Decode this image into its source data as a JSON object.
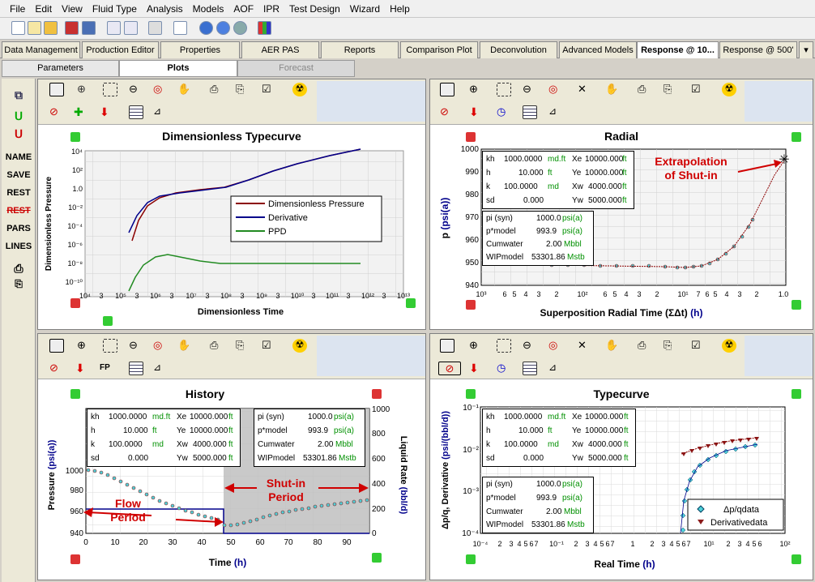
{
  "menu": [
    "File",
    "Edit",
    "View",
    "Fluid Type",
    "Analysis",
    "Models",
    "AOF",
    "IPR",
    "Test Design",
    "Wizard",
    "Help"
  ],
  "tabs": [
    "Data Management",
    "Production Editor",
    "Properties",
    "AER PAS",
    "Reports",
    "Comparison Plot",
    "Deconvolution",
    "Advanced Models",
    "Response @ 10...",
    "Response @ 500'"
  ],
  "subtabs": [
    "Parameters",
    "Plots",
    "Forecast"
  ],
  "left_buttons": [
    "NAME",
    "SAVE",
    "REST",
    "REST",
    "PARS",
    "LINES"
  ],
  "colors": {
    "pressure": "#8b0000",
    "derivative": "#00008b",
    "ppd": "#228b22",
    "data_marker": "#4fd1d9",
    "deriv_marker": "#8b1a1a",
    "accent": "#d00000"
  },
  "reservoir": {
    "kh_label": "kh",
    "kh_val": "1000.0000",
    "kh_unit": "md.ft",
    "xe_label": "Xe",
    "xe_val": "10000.000",
    "xe_unit": "ft",
    "h_label": "h",
    "h_val": "10.000",
    "h_unit": "ft",
    "ye_label": "Ye",
    "ye_val": "10000.000",
    "ye_unit": "ft",
    "k_label": "k",
    "k_val": "100.0000",
    "k_unit": "md",
    "xw_label": "Xw",
    "xw_val": "4000.000",
    "xw_unit": "ft",
    "sd_label": "sd",
    "sd_val": "0.000",
    "yw_label": "Yw",
    "yw_val": "5000.000",
    "yw_unit": "ft"
  },
  "results": {
    "pi_label": "pi (syn)",
    "pi_val": "1000.0",
    "pi_unit": "psi(a)",
    "ps_label": "p*model",
    "ps_val": "993.9",
    "ps_unit": "psi(a)",
    "cum_label": "Cumwater",
    "cum_val": "2.00",
    "cum_unit": "Mbbl",
    "wip_label": "WIPmodel",
    "wip_val": "53301.86",
    "wip_unit": "Mstb"
  },
  "dtc": {
    "title": "Dimensionless Typecurve",
    "xlabel": "Dimensionless Time",
    "ylabel": "Dimensionless Pressure",
    "legend": [
      "Dimensionless Pressure",
      "Derivative",
      "PPD"
    ],
    "xticks": [
      "10⁴",
      "3",
      "10⁵",
      "3",
      "10⁶",
      "3",
      "10⁷",
      "3",
      "10⁸",
      "3",
      "10⁹",
      "3",
      "10¹⁰",
      "3",
      "10¹¹",
      "3",
      "10¹²",
      "3",
      "10¹³"
    ],
    "yticks": [
      "10⁴",
      "10²",
      "1.0",
      "10⁻²",
      "10⁻⁴",
      "10⁻⁶",
      "10⁻⁸",
      "10⁻¹⁰"
    ]
  },
  "radial": {
    "title": "Radial",
    "xlabel": "Superposition Radial Time (ΣΔt)",
    "xunit": "(h)",
    "ylabel": "p",
    "yunit": "(psi(a))",
    "annotation": [
      "Extrapolation",
      "of Shut-in"
    ],
    "yticks": [
      "1000",
      "990",
      "980",
      "970",
      "960",
      "950",
      "940"
    ],
    "xticks": [
      "10³",
      "6",
      "5",
      "4",
      "3",
      "2",
      "10²",
      "6",
      "5",
      "4",
      "3",
      "2",
      "10¹",
      "7",
      "6",
      "5",
      "4",
      "3",
      "2",
      "1.0"
    ]
  },
  "history": {
    "title": "History",
    "xlabel": "Time",
    "xunit": "(h)",
    "ylabel": "Pressure",
    "yunit": "(psi(a))",
    "y2label": "Liquid Rate",
    "y2unit": "(bbl/d)",
    "yticks": [
      "1000",
      "980",
      "960",
      "940"
    ],
    "y2ticks": [
      "1000",
      "800",
      "600",
      "400",
      "200",
      "0"
    ],
    "xticks": [
      "0",
      "10",
      "20",
      "30",
      "40",
      "50",
      "60",
      "70",
      "80",
      "90"
    ],
    "shutin": [
      "Shut-in",
      "Period"
    ],
    "flow": [
      "Flow",
      "Period"
    ]
  },
  "typecurve": {
    "title": "Typecurve",
    "xlabel": "Real Time",
    "xunit": "(h)",
    "ylabel": "Δp/q, Derivative",
    "yunit": "(psi/(bbl/d))",
    "yticks": [
      "10⁻¹",
      "10⁻²",
      "10⁻³",
      "10⁻⁴"
    ],
    "xticks": [
      "10⁻⁴",
      "2",
      "3",
      "4",
      "5",
      "6",
      "7",
      "10⁻¹",
      "2",
      "3",
      "4",
      "5",
      "6",
      "7",
      "1",
      "2",
      "3",
      "4",
      "5",
      "6",
      "7",
      "10¹",
      "2",
      "3",
      "4",
      "5",
      "6",
      "10²"
    ],
    "legend": [
      "Δp/qdata",
      "Derivativedata"
    ]
  },
  "fp_label": "FP",
  "chart_data": [
    {
      "type": "line",
      "title": "Dimensionless Typecurve",
      "xlabel": "Dimensionless Time",
      "ylabel": "Dimensionless Pressure",
      "log_x": true,
      "log_y": true,
      "xlim": [
        10000,
        10000000000000.0
      ],
      "ylim": [
        1e-10,
        10000
      ],
      "series": [
        {
          "name": "Dimensionless Pressure",
          "x": [
            300000.0,
            1000000.0,
            10000000.0,
            100000000.0,
            1000000000.0,
            10000000000.0,
            100000000000.0,
            1000000000000.0
          ],
          "y": [
            1e-05,
            0.03,
            0.15,
            0.5,
            3,
            20,
            150,
            1000
          ]
        },
        {
          "name": "Derivative",
          "x": [
            300000.0,
            1000000.0,
            10000000.0,
            100000000.0,
            1000000000.0,
            10000000000.0,
            100000000000.0,
            1000000000000.0
          ],
          "y": [
            5e-05,
            0.05,
            0.12,
            0.5,
            3,
            20,
            150,
            1000
          ]
        },
        {
          "name": "PPD",
          "x": [
            300000.0,
            1000000.0,
            3000000.0,
            10000000.0,
            100000000.0,
            1000000000.0,
            10000000000.0,
            100000000000.0,
            1000000000000.0
          ],
          "y": [
            3e-10,
            1e-07,
            2e-07,
            1e-07,
            1e-08,
            1e-08,
            1e-08,
            1e-08,
            1e-08
          ]
        }
      ]
    },
    {
      "type": "scatter",
      "title": "Radial",
      "xlabel": "Superposition Radial Time (ΣΔt) (h)",
      "ylabel": "p (psi(a))",
      "ylim": [
        940,
        1000
      ],
      "series": [
        {
          "name": "data",
          "x": [
            1000,
            500,
            200,
            100,
            50,
            20,
            10,
            5,
            3,
            2,
            1.5,
            1.2,
            1.0
          ],
          "y": [
            950,
            950,
            949,
            948,
            948,
            948,
            948,
            950,
            955,
            965,
            978,
            988,
            994
          ]
        }
      ]
    },
    {
      "type": "line",
      "title": "History",
      "xlabel": "Time (h)",
      "ylabel": "Pressure (psi(a))",
      "xlim": [
        0,
        98
      ],
      "ylim": [
        940,
        1000
      ],
      "series": [
        {
          "name": "pressure",
          "x": [
            0,
            5,
            10,
            20,
            30,
            40,
            48,
            50,
            60,
            70,
            80,
            90,
            98
          ],
          "y": [
            1000,
            999,
            996,
            987,
            976,
            966,
            948,
            948,
            953,
            961,
            965,
            969,
            971
          ]
        },
        {
          "name": "rate",
          "x": [
            0,
            48,
            48.1,
            98
          ],
          "y": [
            80,
            80,
            0,
            0
          ]
        }
      ]
    },
    {
      "type": "scatter",
      "title": "Typecurve",
      "xlabel": "Real Time (h)",
      "ylabel": "Δp/q, Derivative (psi/(bbl/d))",
      "log_x": true,
      "log_y": true,
      "xlim": [
        0.0001,
        100
      ],
      "ylim": [
        0.0001,
        0.1
      ],
      "series": [
        {
          "name": "Δp/qdata",
          "x": [
            10,
            11,
            12,
            15,
            20,
            30,
            40,
            50
          ],
          "y": [
            0.0002,
            0.0008,
            0.0013,
            0.0022,
            0.003,
            0.004,
            0.0045,
            0.005
          ]
        },
        {
          "name": "Derivativedata",
          "x": [
            10,
            12,
            15,
            20,
            30,
            40,
            50
          ],
          "y": [
            0.005,
            0.0055,
            0.006,
            0.0065,
            0.007,
            0.0072,
            0.0075
          ]
        }
      ]
    }
  ]
}
